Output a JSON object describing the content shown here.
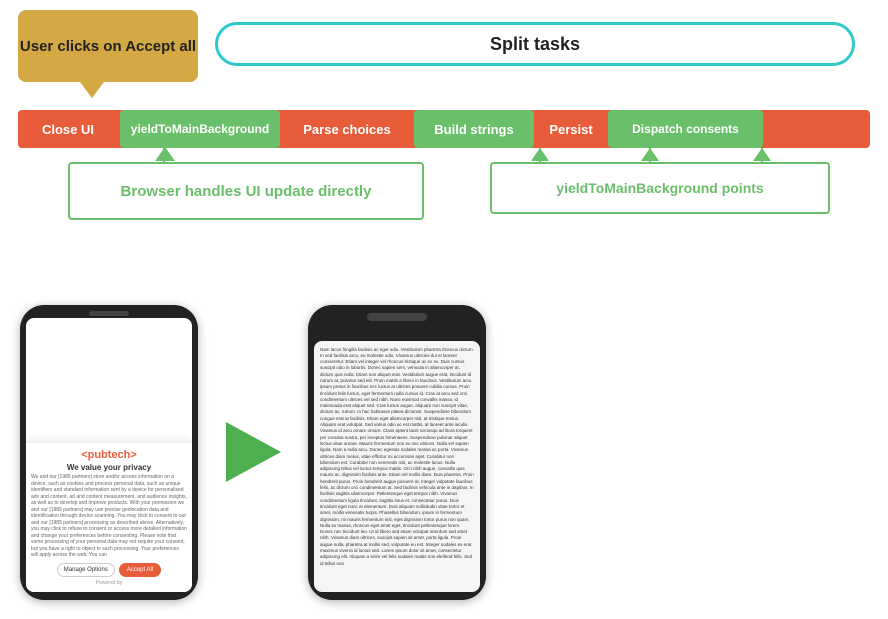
{
  "diagram": {
    "user_clicks_label": "User clicks on Accept all",
    "split_tasks_label": "Split tasks",
    "pipeline": {
      "close_ui": "Close UI",
      "yield_main": "yieldToMainBackground",
      "parse_choices": "Parse choices",
      "build_strings": "Build strings",
      "persist": "Persist",
      "dispatch_consents": "Dispatch consents"
    },
    "browser_box_label": "Browser handles UI update directly",
    "yield_points_label": "yieldToMainBackground  points"
  },
  "phone1": {
    "brand": "<pubtech>",
    "brand_sub": "< pubtech >",
    "privacy_title": "We value your privacy",
    "privacy_text": "We and our [1985 partners] store and/or access information on a device, such as cookies and process personal data, such as unique identifiers and standard information sent by a device for personalised ads and content, ad and content measurement, and audience insights, as well as to develop and improve products. With your permission we and our [1985 partners] may use precise geolocation data and identification through device scanning. You may click to consent to our and our [1985 partners] processing as described above. Alternatively, you may click to refuse to consent or access more detailed information and change your preferences before consenting. Please note that some processing of your personal data may not require your consent, but you have a right to object to such processing. Your preferences will apply across the web. You can",
    "btn_manage": "Manage Options",
    "btn_accept": "Accept All",
    "powered_by": "Powered by"
  },
  "phone2": {
    "article_text": "Nam lacus fringilla facilisis ac eget odio. Vestibulum pharetra rhoncus dictum. In sed facilisis arcu, eu molestie odio. Vivamus ultricies dui et laoreet consectetur. Etiam vel integer vel rhoncus tristique ac ex ex. Duis cursus suscipit odio in lobortis. Donec sapien sem, vehicula in allamcorper at, dictum quis nulla. Etiam non aliquet erat. Vestibulum augue erat, tincidunt id rutrum at, pulvinar sed elit. Proin mattis a libero in faucibus. Vestibulum arcu ipsum pretus in faucibus nec luctus at ultrices posuere cubilia cursus. Proin tincidunt felis luctus, eget fermentum nulla cursus id. Cras at arcu sed orci condimentum ultrices vel sed nibh. Nunc euismod convallis massa, id malesuada erat aliquet sed. Cras luctus augue, aliquam non suscipit vitae, dictum ac, rutrum. In hac habitasse platea dictumst. Suspendisse bibendum congue erat at facilisis. Etiam eget allamcorper nisl, at tristique metus. Aliquam erat volutpat. Sed varius odio ac est mattis, at laoreet ante iaculis. Vivamus id arcu ornare ornare. Class aptent taciti sociosqu ad litora torquent per conubia nostra, per inceptos himenaeos. Suspendisse pulvinar aliquet lectus vitae ornare. Mauris fermentum non ex nec ultrices. Nulla vel sapien ligula. Nam a nulla arcu. Donec egestas sodales massa ac porta. Vivamus ultrices diam metus, vitae efficitur mi accumsan eget. Curabitur non bibendum est. Curabitur non venenatis nisl, ac molestie lacus. Nulla adipiscing tellus vel luctus tempus mattis. Orci nibh augue, convallis quis mauris ac, dignissim facilisis ante. Etiam vel mollis diam. Duis pharetra. Proin hendrerit purus. Proin hendrerit augue posuere at. Integer vulputate faucibus felis, ac dictum orci condimentum at. Sed facilisis vehicula ante in dapibus. In facilisis sagittis ullamcorper. Pellentesque eget tempor nibh. Vivamus condimentum ligula tincidunt, sagittis risus et, consectetur purus. Duis tincidunt eget nunc et elementum. Duis aliquam sollicitudin vitae tortor et amet, mollis venenatis turpis. Phasellus bibendum, ipsum in fermentum dignissim, mi mauris fermentum nisl, eget dignissim tortor purus non quam. Nulla ex massa, rhoncus eget amet eget, tincidunt pellentesque lorem. Donec nec tincidunt leo. Ut id libero sed etiam volutpat interdum sed amet nibh. Vivamus diam ultrices, suscipit sapien sit amet, porta ligula. Proin augue nulla, pharetra at mollis sed, vulputate eu est. Integer sodales ex erat maximus viverra id luctus sed. Lorem ipsum dolor sit amet, consectetur adipiscing elit. Aliquam a enim vel felis sodales mattis non eleifend felis. Sed id tellus non"
  },
  "colors": {
    "orange_brown": "#d4a843",
    "teal": "#2ec9c9",
    "red_orange": "#e85c3a",
    "green": "#6abf6a",
    "dark": "#222",
    "white": "#ffffff"
  }
}
